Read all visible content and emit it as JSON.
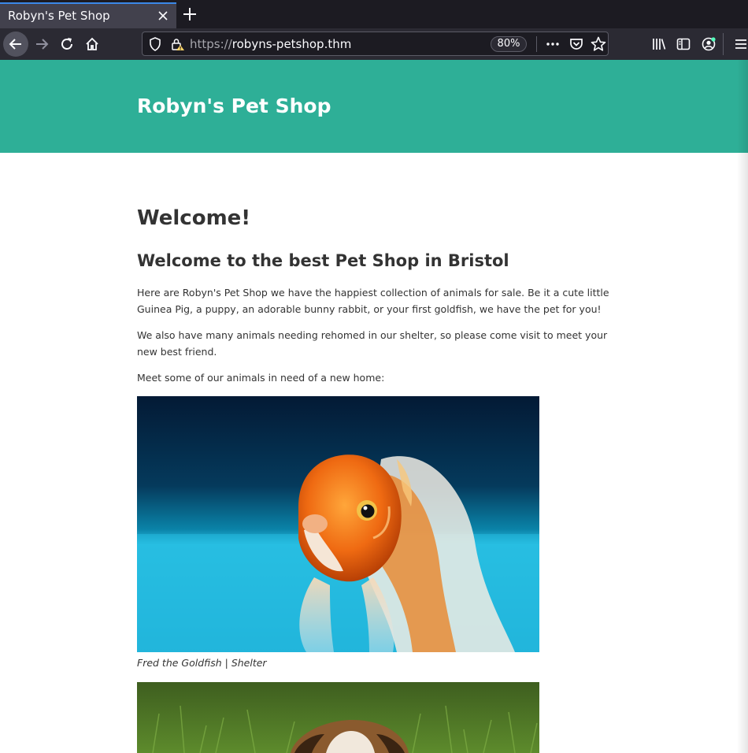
{
  "browser": {
    "tab_title": "Robyn's Pet Shop",
    "url_scheme": "https://",
    "url_host": "robyns-petshop.thm",
    "zoom": "80%",
    "icons": [
      "arrow-left-icon",
      "arrow-right-icon",
      "reload-icon",
      "home-icon",
      "shield-icon",
      "lock-warning-icon",
      "more-icon",
      "pocket-icon",
      "star-icon",
      "library-icon",
      "sidebar-icon",
      "account-icon",
      "menu-icon",
      "close-icon",
      "plus-icon"
    ]
  },
  "site": {
    "title": "Robyn's Pet Shop",
    "header_color": "#2eaf97"
  },
  "main": {
    "heading": "Welcome!",
    "subheading": "Welcome to the best Pet Shop in Bristol",
    "paragraphs": [
      "Here are Robyn's Pet Shop we have the happiest collection of animals for sale. Be it a cute little Guinea Pig, a puppy, an adorable bunny rabbit, or your first goldfish, we have the pet for you!",
      "We also have many animals needing rehomed in our shelter, so please come visit to meet your new best friend.",
      "Meet some of our animals in need of a new home:"
    ],
    "pets": [
      {
        "caption": "Fred the Goldfish | Shelter"
      }
    ]
  }
}
